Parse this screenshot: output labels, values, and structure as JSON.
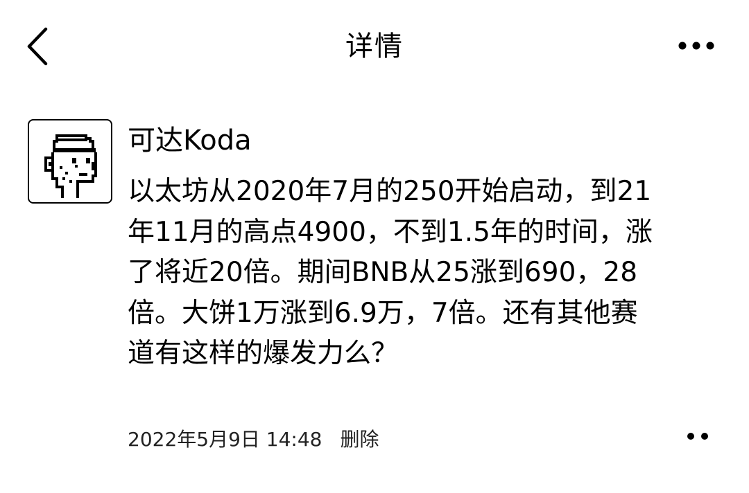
{
  "header": {
    "title": "详情",
    "back_icon": "chevron-left-icon",
    "more_icon": "more-horizontal-icon"
  },
  "post": {
    "author": "可达Koda",
    "avatar_icon": "pixel-avatar-cap-icon",
    "body_lines": [
      "以太坊从2020年7月的250开始启动，到21",
      "年11月的高点4900，不到1.5年的时间，涨",
      "了将近20倍。期间BNB从25涨到690，28",
      "倍。大饼1万涨到6.9万，7倍。还有其他赛",
      "道有这样的爆发力么？"
    ],
    "timestamp": "2022年5月9日 14:48",
    "delete_label": "删除",
    "options_icon": "more-dots-icon"
  },
  "colors": {
    "background": "#ffffff",
    "text": "#000000"
  }
}
